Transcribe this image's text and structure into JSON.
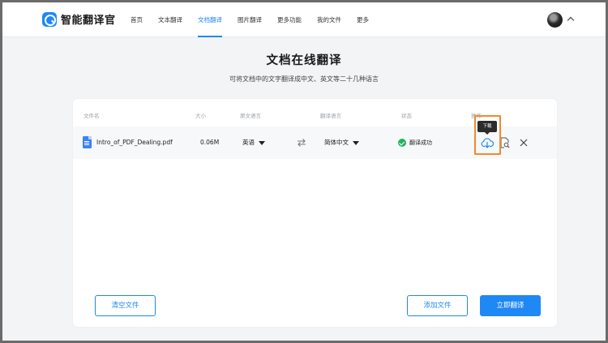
{
  "app": {
    "logo_text": "智能翻译官"
  },
  "nav": {
    "items": [
      "首页",
      "文本翻译",
      "文档翻译",
      "图片翻译",
      "更多功能",
      "我的文件",
      "更多"
    ],
    "active_index": 2
  },
  "page": {
    "title": "文档在线翻译",
    "subtitle": "可将文档中的文字翻译成中文、英文等二十几种语言"
  },
  "table": {
    "columns": {
      "file_name": "文件名",
      "size": "大小",
      "source_language": "原文语言",
      "target_language": "翻译语言",
      "status": "状态",
      "actions": "操作"
    },
    "rows": [
      {
        "file_name": "Intro_of_PDF_Dealing.pdf",
        "size": "0.06M",
        "source_language": "英语",
        "target_language": "简体中文",
        "status": "翻译成功"
      }
    ]
  },
  "tooltip": {
    "download": "下载"
  },
  "buttons": {
    "clear": "清空文件",
    "add": "添加文件",
    "translate": "立即翻译"
  },
  "icons": {
    "logo": "translate-logo-icon",
    "file": "pdf-file-icon",
    "swap": "swap-arrows-icon",
    "status": "check-circle-icon",
    "download": "cloud-download-icon",
    "preview": "document-search-icon",
    "remove": "close-icon",
    "user_menu": "chevron-up-icon"
  },
  "colors": {
    "accent": "#1e88f5",
    "success": "#22b35e",
    "highlight": "#f08a2c"
  }
}
